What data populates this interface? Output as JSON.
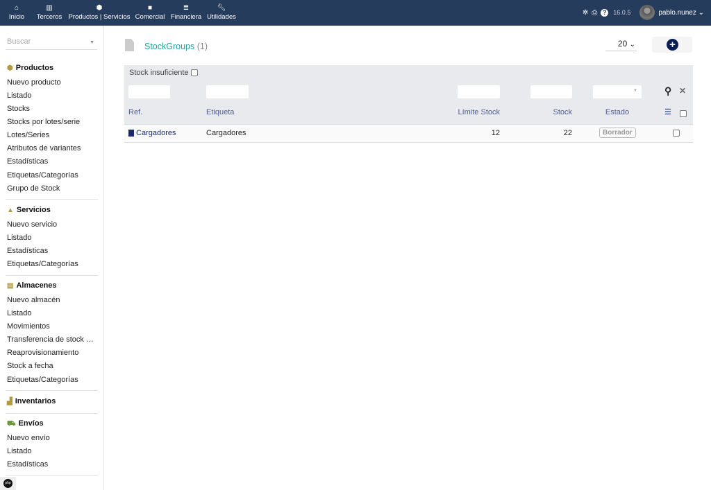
{
  "topnav": {
    "items": [
      {
        "label": "Inicio",
        "icon": "home-icon"
      },
      {
        "label": "Terceros",
        "icon": "building-icon"
      },
      {
        "label": "Productos | Servicios",
        "icon": "cube-icon"
      },
      {
        "label": "Comercial",
        "icon": "briefcase-icon"
      },
      {
        "label": "Financiera",
        "icon": "money-icon"
      },
      {
        "label": "Utilidades",
        "icon": "wrench-icon"
      }
    ],
    "version": "16.0.5",
    "user": "pablo.nunez"
  },
  "sidebar": {
    "search_placeholder": "Buscar",
    "productos": {
      "title": "Productos",
      "items": [
        "Nuevo producto",
        "Listado",
        "Stocks",
        "Stocks por lotes/serie",
        "Lotes/Series",
        "Atributos de variantes",
        "Estadísticas",
        "Etiquetas/Categorías",
        "Grupo de Stock"
      ]
    },
    "servicios": {
      "title": "Servicios",
      "items": [
        "Nuevo servicio",
        "Listado",
        "Estadísticas",
        "Etiquetas/Categorías"
      ]
    },
    "almacenes": {
      "title": "Almacenes",
      "items": [
        "Nuevo almacén",
        "Listado",
        "Movimientos",
        "Transferencia de stock en masa",
        "Reaprovisionamiento",
        "Stock a fecha",
        "Etiquetas/Categorías"
      ]
    },
    "inventarios": {
      "title": "Inventarios"
    },
    "envios": {
      "title": "Envíos",
      "items": [
        "Nuevo envío",
        "Listado",
        "Estadísticas"
      ]
    }
  },
  "main": {
    "title": "StockGroups",
    "count": "(1)",
    "limit": "20",
    "filter_label": "Stock insuficiente",
    "columns": {
      "ref": "Ref.",
      "label": "Etiqueta",
      "limit": "Límite Stock",
      "stock": "Stock",
      "status": "Estado"
    },
    "rows": [
      {
        "ref": "Cargadores",
        "label": "Cargadores",
        "limit": "12",
        "stock": "22",
        "status": "Borrador"
      }
    ]
  }
}
